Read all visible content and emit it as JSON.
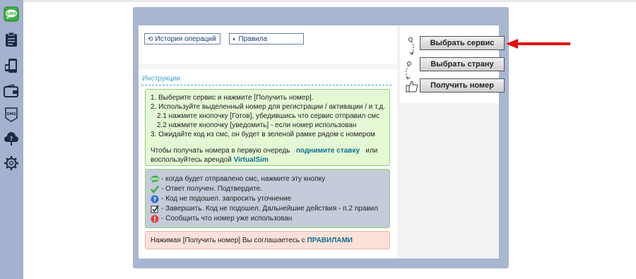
{
  "sidebar": {
    "items": [
      {
        "icon": "sms-app-icon",
        "label": "SMS"
      },
      {
        "icon": "clipboard-icon"
      },
      {
        "icon": "phone-icon"
      },
      {
        "icon": "wallet-icon"
      },
      {
        "icon": "sms-badge-icon",
        "label": "SMS"
      },
      {
        "icon": "help-cloud-icon"
      },
      {
        "icon": "gear-icon"
      }
    ]
  },
  "tabs": {
    "history": "История операций",
    "rules": "Правила"
  },
  "instructions": {
    "title": "Инструкции",
    "steps": [
      "1. Выберите сервис и нажмите [Получить номер].",
      "2. Используйте выделенный номер для регистрации / активации / и т.д.",
      "2.1 нажмите кнопочку [Готов], убедившись что сервис отправил смс",
      "2.2 нажмите кнопочку [уведомить] - если номер использован",
      "3. Ожидайте код из смс, он будет в зеленой рамке рядом с номером"
    ],
    "priority_line1_pre": "Чтобы получать номера в первую очередь",
    "priority_link": "поднимите ставку",
    "priority_line1_post": "или",
    "priority_line2_pre": "воспользуйтесь арендой",
    "priority_link2": "VirtualSim"
  },
  "legend": [
    "- когда будет отправлено смс, нажмите эту кнопку",
    "- Ответ получен. Подтвердите.",
    "- Код не подошел. запросить уточнение",
    "- Завершить. Код не подошел. Дальнейшие действия - п.2 правил",
    "- Сообщить что номер уже использован"
  ],
  "agreement": {
    "text": "Нажимая [Получить номер] Вы соглашаетесь с",
    "link": "ПРАВИЛАМИ"
  },
  "actions": {
    "select_service": "Выбрать сервис",
    "select_country": "Выбрать страну",
    "get_number": "Получить номер"
  },
  "colors": {
    "sidebar": "#a3b3cf",
    "panel": "#a8b6d0",
    "accent": "#3aa3c6",
    "arrow": "#e01010",
    "green_box": "#e4f8d4",
    "gray_box": "#c4cbd9",
    "pink_box": "#fbe1d9"
  }
}
